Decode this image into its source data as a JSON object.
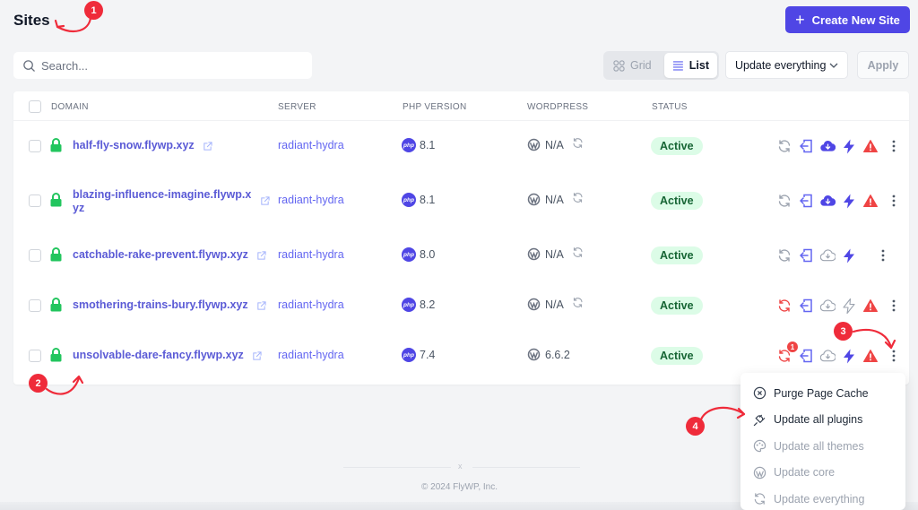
{
  "header": {
    "title": "Sites",
    "create_button": "Create New Site"
  },
  "toolbar": {
    "search_placeholder": "Search...",
    "search_value": "",
    "view_options": [
      {
        "label": "Grid",
        "active": false
      },
      {
        "label": "List",
        "active": true
      }
    ],
    "bulk_action_selected": "Update everything",
    "apply_label": "Apply"
  },
  "table": {
    "columns": [
      "DOMAIN",
      "SERVER",
      "PHP VERSION",
      "WORDPRESS",
      "STATUS"
    ],
    "rows": [
      {
        "domain": "half-fly-snow.flywp.xyz",
        "server": "radiant-hydra",
        "php": "8.1",
        "wordpress": "N/A",
        "wp_refresh": true,
        "status": "Active",
        "actions": {
          "sync": "idle",
          "login": "enabled",
          "backup": "active",
          "cache": "active",
          "warning": true,
          "sync_badge": null
        }
      },
      {
        "domain": "blazing-influence-imagine.flywp.xyz",
        "server": "radiant-hydra",
        "php": "8.1",
        "wordpress": "N/A",
        "wp_refresh": true,
        "status": "Active",
        "actions": {
          "sync": "idle",
          "login": "enabled",
          "backup": "active",
          "cache": "active",
          "warning": true,
          "sync_badge": null
        }
      },
      {
        "domain": "catchable-rake-prevent.flywp.xyz",
        "server": "radiant-hydra",
        "php": "8.0",
        "wordpress": "N/A",
        "wp_refresh": true,
        "status": "Active",
        "actions": {
          "sync": "idle",
          "login": "enabled",
          "backup": "inactive",
          "cache": "active",
          "warning": false,
          "sync_badge": null
        }
      },
      {
        "domain": "smothering-trains-bury.flywp.xyz",
        "server": "radiant-hydra",
        "php": "8.2",
        "wordpress": "N/A",
        "wp_refresh": true,
        "status": "Active",
        "actions": {
          "sync": "alert",
          "login": "enabled",
          "backup": "inactive",
          "cache": "inactive",
          "warning": true,
          "sync_badge": null
        }
      },
      {
        "domain": "unsolvable-dare-fancy.flywp.xyz",
        "server": "radiant-hydra",
        "php": "7.4",
        "wordpress": "6.6.2",
        "wp_refresh": false,
        "status": "Active",
        "actions": {
          "sync": "alert",
          "login": "enabled",
          "backup": "inactive",
          "cache": "active",
          "warning": true,
          "sync_badge": "1"
        }
      }
    ]
  },
  "dropdown_menu": {
    "items": [
      {
        "label": "Purge Page Cache",
        "icon": "x-circle-icon",
        "enabled": true
      },
      {
        "label": "Update all plugins",
        "icon": "plug-icon",
        "enabled": true
      },
      {
        "label": "Update all themes",
        "icon": "palette-icon",
        "enabled": false
      },
      {
        "label": "Update core",
        "icon": "wordpress-icon",
        "enabled": false
      },
      {
        "label": "Update everything",
        "icon": "refresh-icon",
        "enabled": false
      }
    ]
  },
  "footer": {
    "separator": "x",
    "copyright": "© 2024 FlyWP, Inc."
  },
  "annotations": [
    "1",
    "2",
    "3",
    "4"
  ],
  "colors": {
    "accent": "#4f46e5",
    "link": "#5b5bd6",
    "status_active_bg": "#dcfce7",
    "status_active_text": "#166534",
    "danger": "#ef4444",
    "lock": "#22c55e"
  }
}
